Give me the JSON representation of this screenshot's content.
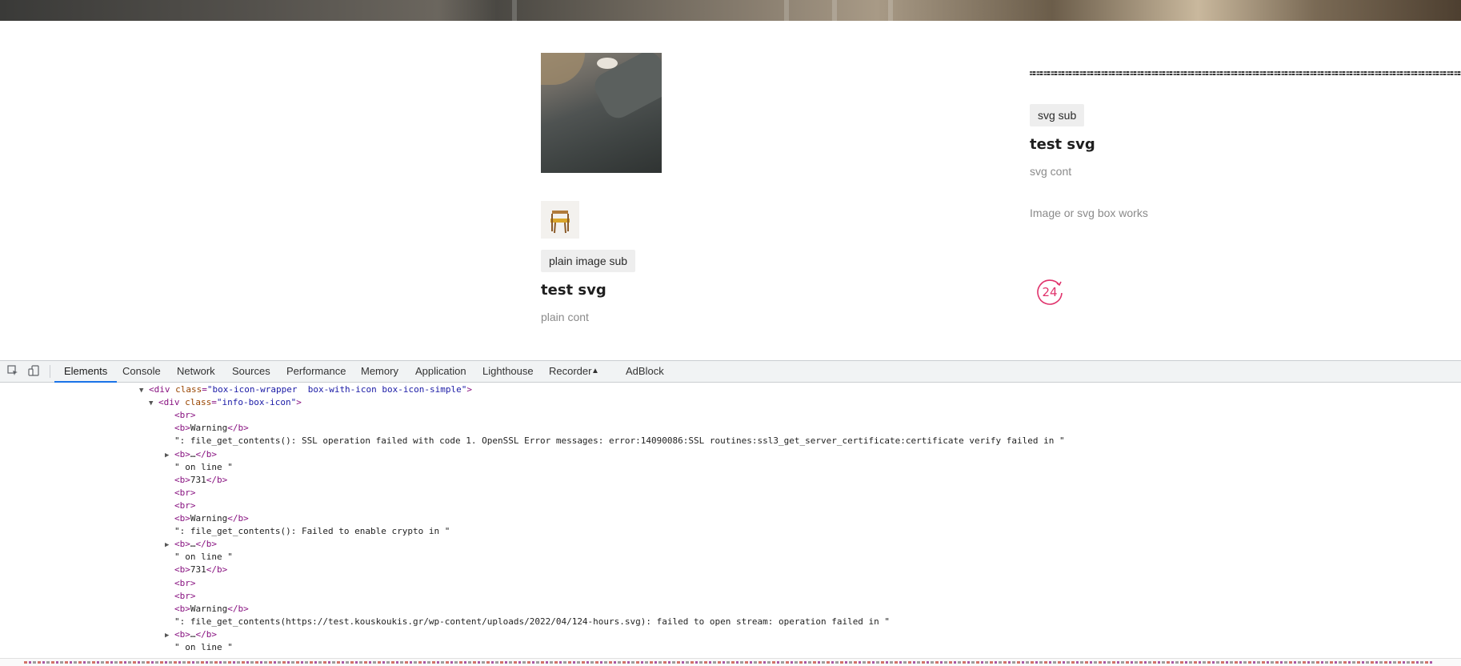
{
  "page": {
    "left_box": {
      "badge": "plain image sub",
      "title": "test svg",
      "content": "plain cont"
    },
    "right_box": {
      "badge": "svg sub",
      "title": "test svg",
      "content": "svg cont",
      "note": "Image or svg box works",
      "icon_text": "24"
    },
    "accent_color": "#e0336c"
  },
  "devtools": {
    "tabs": [
      "Elements",
      "Console",
      "Network",
      "Sources",
      "Performance",
      "Memory",
      "Application",
      "Lighthouse",
      "Recorder",
      "AdBlock"
    ],
    "active_tab": "Elements",
    "code_lines": [
      {
        "indent": 0,
        "tri": "▼",
        "tag_open": "<div ",
        "attr_name": "class",
        "attr_eq": "=",
        "attr_val": "\"box-icon-wrapper  box-with-icon box-icon-simple\"",
        "tag_close": ">",
        "text": ""
      },
      {
        "indent": 1,
        "tri": "▼",
        "tag_open": "<div ",
        "attr_name": "class",
        "attr_eq": "=",
        "attr_val": "\"info-box-icon\"",
        "tag_close": ">",
        "text": ""
      },
      {
        "indent": 2,
        "tri": "",
        "tag_open": "<br>",
        "attr_name": "",
        "attr_eq": "",
        "attr_val": "",
        "tag_close": "",
        "text": ""
      },
      {
        "indent": 2,
        "tri": "",
        "tag_open": "<b>",
        "attr_name": "",
        "attr_eq": "",
        "attr_val": "",
        "tag_close": "</b>",
        "text": "Warning"
      },
      {
        "indent": 2,
        "tri": "",
        "tag_open": "",
        "attr_name": "",
        "attr_eq": "",
        "attr_val": "",
        "tag_close": "",
        "text": "\": file_get_contents(): SSL operation failed with code 1. OpenSSL Error messages: error:14090086:SSL routines:ssl3_get_server_certificate:certificate verify failed in \""
      },
      {
        "indent": 2,
        "tri": "▶",
        "tag_open": "<b>",
        "attr_name": "",
        "attr_eq": "",
        "attr_val": "",
        "tag_close": "</b>",
        "text": "…"
      },
      {
        "indent": 2,
        "tri": "",
        "tag_open": "",
        "attr_name": "",
        "attr_eq": "",
        "attr_val": "",
        "tag_close": "",
        "text": "\" on line \""
      },
      {
        "indent": 2,
        "tri": "",
        "tag_open": "<b>",
        "attr_name": "",
        "attr_eq": "",
        "attr_val": "",
        "tag_close": "</b>",
        "text": "731"
      },
      {
        "indent": 2,
        "tri": "",
        "tag_open": "<br>",
        "attr_name": "",
        "attr_eq": "",
        "attr_val": "",
        "tag_close": "",
        "text": ""
      },
      {
        "indent": 2,
        "tri": "",
        "tag_open": "<br>",
        "attr_name": "",
        "attr_eq": "",
        "attr_val": "",
        "tag_close": "",
        "text": ""
      },
      {
        "indent": 2,
        "tri": "",
        "tag_open": "<b>",
        "attr_name": "",
        "attr_eq": "",
        "attr_val": "",
        "tag_close": "</b>",
        "text": "Warning"
      },
      {
        "indent": 2,
        "tri": "",
        "tag_open": "",
        "attr_name": "",
        "attr_eq": "",
        "attr_val": "",
        "tag_close": "",
        "text": "\": file_get_contents(): Failed to enable crypto in \""
      },
      {
        "indent": 2,
        "tri": "▶",
        "tag_open": "<b>",
        "attr_name": "",
        "attr_eq": "",
        "attr_val": "",
        "tag_close": "</b>",
        "text": "…"
      },
      {
        "indent": 2,
        "tri": "",
        "tag_open": "",
        "attr_name": "",
        "attr_eq": "",
        "attr_val": "",
        "tag_close": "",
        "text": "\" on line \""
      },
      {
        "indent": 2,
        "tri": "",
        "tag_open": "<b>",
        "attr_name": "",
        "attr_eq": "",
        "attr_val": "",
        "tag_close": "</b>",
        "text": "731"
      },
      {
        "indent": 2,
        "tri": "",
        "tag_open": "<br>",
        "attr_name": "",
        "attr_eq": "",
        "attr_val": "",
        "tag_close": "",
        "text": ""
      },
      {
        "indent": 2,
        "tri": "",
        "tag_open": "<br>",
        "attr_name": "",
        "attr_eq": "",
        "attr_val": "",
        "tag_close": "",
        "text": ""
      },
      {
        "indent": 2,
        "tri": "",
        "tag_open": "<b>",
        "attr_name": "",
        "attr_eq": "",
        "attr_val": "",
        "tag_close": "</b>",
        "text": "Warning"
      },
      {
        "indent": 2,
        "tri": "",
        "tag_open": "",
        "attr_name": "",
        "attr_eq": "",
        "attr_val": "",
        "tag_close": "",
        "text": "\": file_get_contents(https://test.kouskoukis.gr/wp-content/uploads/2022/04/124-hours.svg): failed to open stream: operation failed in \""
      },
      {
        "indent": 2,
        "tri": "▶",
        "tag_open": "<b>",
        "attr_name": "",
        "attr_eq": "",
        "attr_val": "",
        "tag_close": "</b>",
        "text": "…"
      },
      {
        "indent": 2,
        "tri": "",
        "tag_open": "",
        "attr_name": "",
        "attr_eq": "",
        "attr_val": "",
        "tag_close": "",
        "text": "\" on line \""
      }
    ]
  }
}
